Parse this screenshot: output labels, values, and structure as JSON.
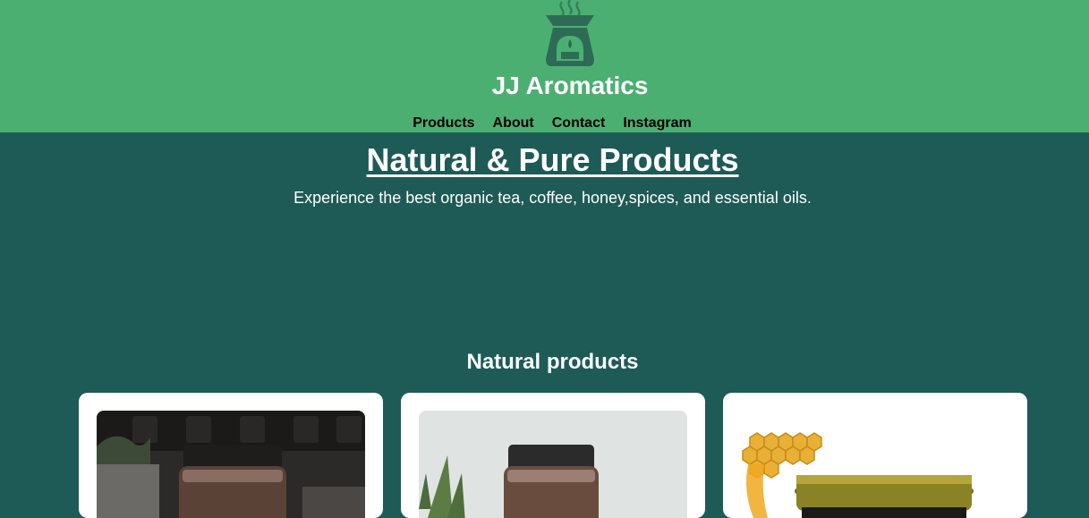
{
  "brand": {
    "name": "JJ Aromatics",
    "logo_icon": "aroma-burner-icon"
  },
  "nav": {
    "items": [
      {
        "label": "Products"
      },
      {
        "label": "About"
      },
      {
        "label": "Contact"
      },
      {
        "label": "Instagram"
      }
    ]
  },
  "hero": {
    "title": "Natural & Pure Products",
    "subtitle": "Experience the best organic tea, coffee, honey,spices, and essential oils."
  },
  "products": {
    "section_title": "Natural products",
    "cards": [
      {
        "image_icon": "brown-jar-shop-photo"
      },
      {
        "image_icon": "brown-jar-aloe-photo"
      },
      {
        "image_icon": "honey-jar-photo"
      }
    ]
  },
  "colors": {
    "header_bg": "#4caf72",
    "page_bg": "#1e5a56",
    "logo": "#2e6b55"
  }
}
